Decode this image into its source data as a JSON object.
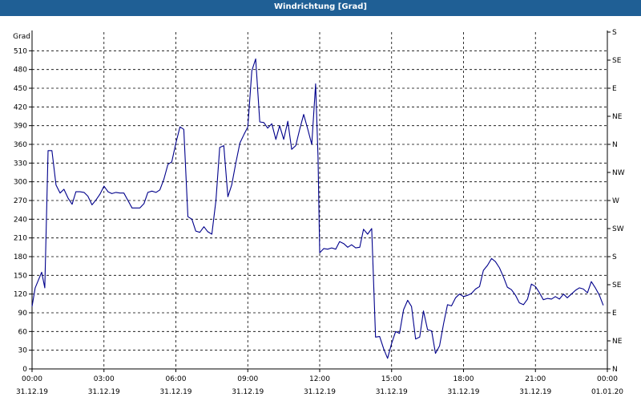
{
  "window": {
    "title": "Windrichtung [Grad]"
  },
  "chart_data": {
    "type": "line",
    "title": "Windrichtung [Grad]",
    "ylabel": "Grad",
    "ylim": [
      0,
      540
    ],
    "yticks": [
      0,
      30,
      60,
      90,
      120,
      150,
      180,
      210,
      240,
      270,
      300,
      330,
      360,
      390,
      420,
      450,
      480,
      510
    ],
    "right_axis_labels": [
      "N",
      "NE",
      "E",
      "SE",
      "S",
      "SW",
      "W",
      "NW",
      "N",
      "NE",
      "E",
      "SE",
      "S"
    ],
    "xlim_hours": [
      0,
      24
    ],
    "xticks": [
      {
        "time": "00:00",
        "date": "31.12.19"
      },
      {
        "time": "03:00",
        "date": "31.12.19"
      },
      {
        "time": "06:00",
        "date": "31.12.19"
      },
      {
        "time": "09:00",
        "date": "31.12.19"
      },
      {
        "time": "12:00",
        "date": "31.12.19"
      },
      {
        "time": "15:00",
        "date": "31.12.19"
      },
      {
        "time": "18:00",
        "date": "31.12.19"
      },
      {
        "time": "21:00",
        "date": "31.12.19"
      },
      {
        "time": "00:00",
        "date": "01.01.20"
      }
    ],
    "grid": true,
    "line_color": "#00008b",
    "series": [
      {
        "x": [
          0.0,
          0.13,
          0.4,
          0.53,
          0.67,
          0.83,
          1.0,
          1.17,
          1.33,
          1.5,
          1.67,
          1.83,
          2.0,
          2.17,
          2.33,
          2.5,
          2.67,
          2.83,
          3.0,
          3.17,
          3.33,
          3.5,
          3.67,
          3.83,
          4.0,
          4.17,
          4.33,
          4.5,
          4.67,
          4.83,
          5.0,
          5.17,
          5.33,
          5.5,
          5.67,
          5.83,
          6.0,
          6.17,
          6.33,
          6.5,
          6.67,
          6.83,
          7.0,
          7.17,
          7.33,
          7.5,
          7.67,
          7.83,
          8.0,
          8.17,
          8.33,
          8.5,
          8.67,
          8.83,
          9.0,
          9.17,
          9.33,
          9.5,
          9.67,
          9.83,
          10.0,
          10.17,
          10.33,
          10.5,
          10.67,
          10.83,
          11.0,
          11.17,
          11.33,
          11.5,
          11.67,
          11.83,
          11.93,
          12.0,
          12.17,
          12.33,
          12.5,
          12.67,
          12.83,
          13.0,
          13.17,
          13.33,
          13.5,
          13.67,
          13.83,
          14.0,
          14.17,
          14.33,
          14.5,
          14.67,
          14.83,
          15.0,
          15.17,
          15.33,
          15.5,
          15.67,
          15.83,
          16.0,
          16.17,
          16.33,
          16.5,
          16.67,
          16.83,
          17.0,
          17.17,
          17.33,
          17.5,
          17.67,
          17.83,
          18.0,
          18.17,
          18.33,
          18.5,
          18.67,
          18.83,
          19.0,
          19.17,
          19.33,
          19.5,
          19.67,
          19.83,
          20.0,
          20.17,
          20.33,
          20.5,
          20.67,
          20.83,
          21.0,
          21.17,
          21.33,
          21.5,
          21.67,
          21.83,
          22.0,
          22.17,
          22.33,
          22.5,
          22.67,
          22.83,
          23.0,
          23.17,
          23.33,
          23.5,
          23.67,
          23.83
        ],
        "y": [
          100,
          130,
          155,
          130,
          350,
          350,
          295,
          282,
          288,
          274,
          264,
          284,
          284,
          283,
          277,
          263,
          271,
          280,
          293,
          284,
          281,
          283,
          282,
          282,
          270,
          258,
          258,
          258,
          265,
          283,
          285,
          283,
          287,
          304,
          328,
          332,
          362,
          388,
          384,
          244,
          240,
          221,
          219,
          228,
          220,
          216,
          270,
          355,
          358,
          276,
          295,
          330,
          362,
          375,
          388,
          478,
          497,
          396,
          395,
          386,
          393,
          368,
          390,
          368,
          397,
          352,
          358,
          385,
          408,
          385,
          360,
          457,
          340,
          186,
          193,
          192,
          194,
          192,
          204,
          201,
          195,
          199,
          194,
          195,
          224,
          216,
          225,
          51,
          52,
          32,
          17,
          41,
          60,
          57,
          95,
          110,
          100,
          48,
          51,
          93,
          63,
          61,
          25,
          37,
          73,
          103,
          101,
          114,
          120,
          116,
          118,
          121,
          128,
          132,
          158,
          166,
          177,
          172,
          162,
          147,
          131,
          127,
          118,
          106,
          103,
          112,
          136,
          132,
          122,
          111,
          113,
          112,
          116,
          112,
          120,
          114,
          120,
          126,
          130,
          128,
          122,
          140,
          130,
          118,
          102
        ]
      }
    ]
  }
}
